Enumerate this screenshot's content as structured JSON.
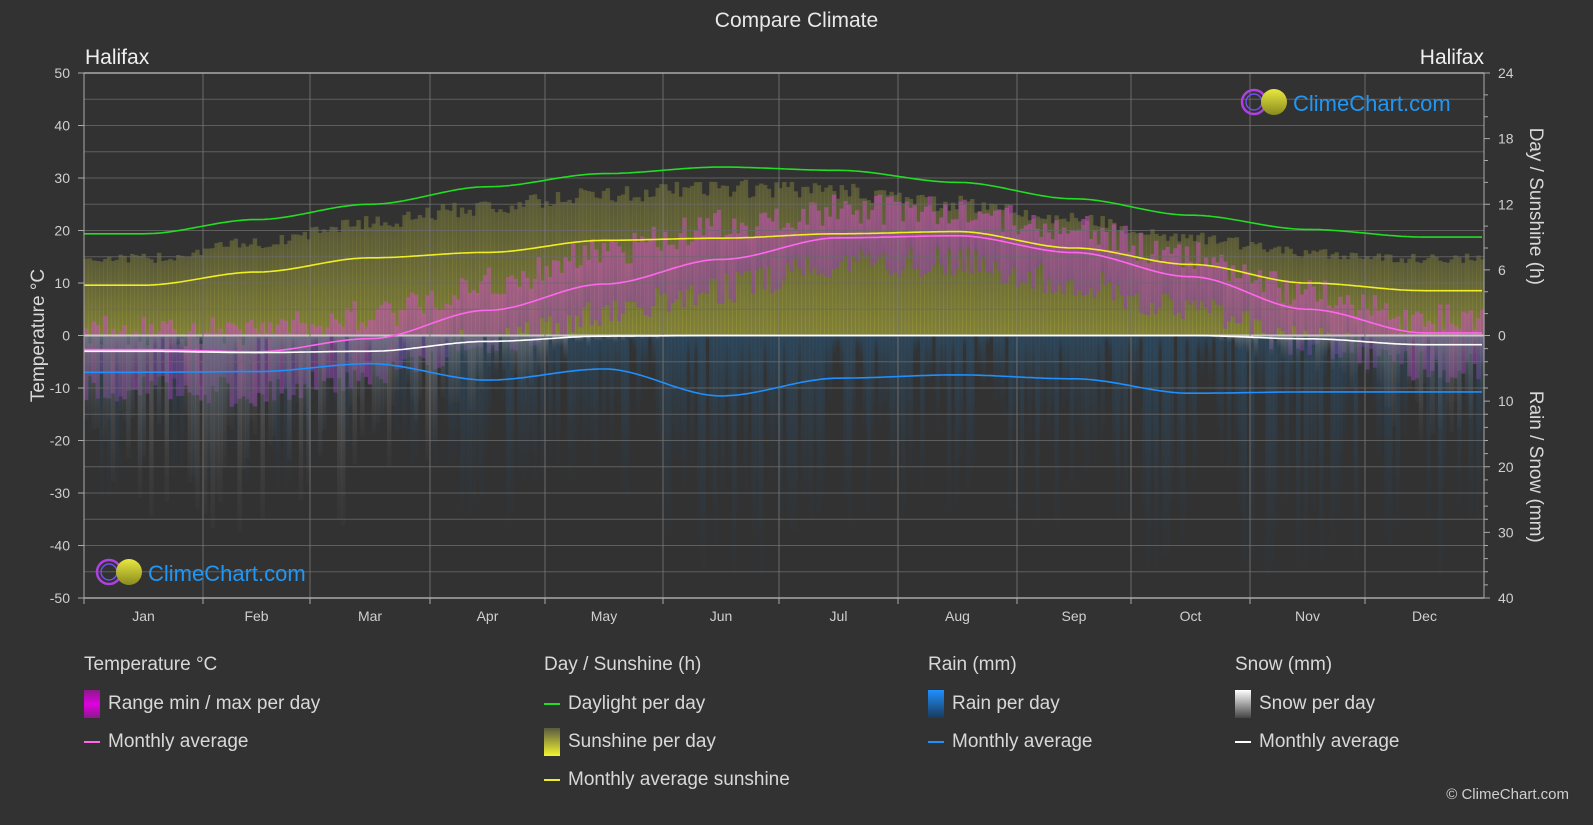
{
  "title": "Compare Climate",
  "city_left": "Halifax",
  "city_right": "Halifax",
  "watermark": "ClimeChart.com",
  "copyright": "© ClimeChart.com",
  "colors": {
    "background": "#323232",
    "grid": "#6a6a6a",
    "temp_line": "#ff66ee",
    "temp_range": "#e000e0",
    "daylight": "#22dd22",
    "sunshine_line": "#eeee22",
    "sunshine_bar": "#c8c832",
    "rain_line": "#1e90ff",
    "rain_bar": "#1e78c8",
    "snow_line": "#ffffff",
    "snow_bar": "#a0a0a0",
    "watermark_text": "#2196f3"
  },
  "legend": {
    "temperature": {
      "title": "Temperature °C",
      "items": [
        "Range min / max per day",
        "Monthly average"
      ]
    },
    "sunshine": {
      "title": "Day / Sunshine (h)",
      "items": [
        "Daylight per day",
        "Sunshine per day",
        "Monthly average sunshine"
      ]
    },
    "rain": {
      "title": "Rain (mm)",
      "items": [
        "Rain per day",
        "Monthly average"
      ]
    },
    "snow": {
      "title": "Snow (mm)",
      "items": [
        "Snow per day",
        "Monthly average"
      ]
    }
  },
  "chart_data": {
    "type": "line",
    "title": "Compare Climate",
    "categories": [
      "Jan",
      "Feb",
      "Mar",
      "Apr",
      "May",
      "Jun",
      "Jul",
      "Aug",
      "Sep",
      "Oct",
      "Nov",
      "Dec"
    ],
    "axes": {
      "left": {
        "label": "Temperature °C",
        "range": [
          -50,
          50
        ],
        "ticks": [
          50,
          40,
          30,
          20,
          10,
          0,
          -10,
          -20,
          -30,
          -40,
          -50
        ]
      },
      "right_top": {
        "label": "Day / Sunshine (h)",
        "range": [
          0,
          24
        ],
        "ticks": [
          24,
          18,
          12,
          6,
          0
        ]
      },
      "right_bottom": {
        "label": "Rain / Snow (mm)",
        "range": [
          0,
          40
        ],
        "ticks": [
          0,
          10,
          20,
          30,
          40
        ]
      }
    },
    "grid": true,
    "series": [
      {
        "name": "Temperature monthly average",
        "axis": "left",
        "unit": "°C",
        "values": [
          -2.7,
          -3.1,
          -0.6,
          4.8,
          9.8,
          14.5,
          18.6,
          19.0,
          15.8,
          11.2,
          5.0,
          0.5
        ]
      },
      {
        "name": "Daylight per day",
        "axis": "right_top",
        "unit": "h",
        "values": [
          9.3,
          10.6,
          12.0,
          13.6,
          14.8,
          15.4,
          15.1,
          14.0,
          12.5,
          11.0,
          9.7,
          9.0
        ]
      },
      {
        "name": "Monthly average sunshine",
        "axis": "right_top",
        "unit": "h",
        "values": [
          4.6,
          5.8,
          7.1,
          7.6,
          8.7,
          8.9,
          9.3,
          9.5,
          8.0,
          6.5,
          4.8,
          4.1
        ]
      },
      {
        "name": "Rain monthly average",
        "axis": "right_bottom",
        "unit": "mm",
        "values": [
          5.6,
          5.5,
          4.3,
          6.8,
          5.1,
          9.2,
          6.5,
          6.0,
          6.6,
          8.8,
          8.6,
          8.6
        ]
      },
      {
        "name": "Snow monthly average",
        "axis": "right_bottom",
        "unit": "mm",
        "values": [
          2.4,
          2.6,
          2.4,
          0.9,
          0.1,
          0.0,
          0.0,
          0.0,
          0.0,
          0.0,
          0.5,
          1.4
        ]
      }
    ],
    "daily_ranges": {
      "sunshine_max_h": [
        7.5,
        9.0,
        11.0,
        12.5,
        13.7,
        14.3,
        14.0,
        12.8,
        11.3,
        9.5,
        8.0,
        7.5
      ],
      "temp_max_c": [
        1,
        1,
        4,
        10,
        16,
        21,
        24,
        24,
        20,
        15,
        8,
        3
      ],
      "temp_min_c": [
        -10,
        -11,
        -7,
        -1,
        4,
        9,
        14,
        14,
        10,
        5,
        -1,
        -6
      ]
    }
  }
}
